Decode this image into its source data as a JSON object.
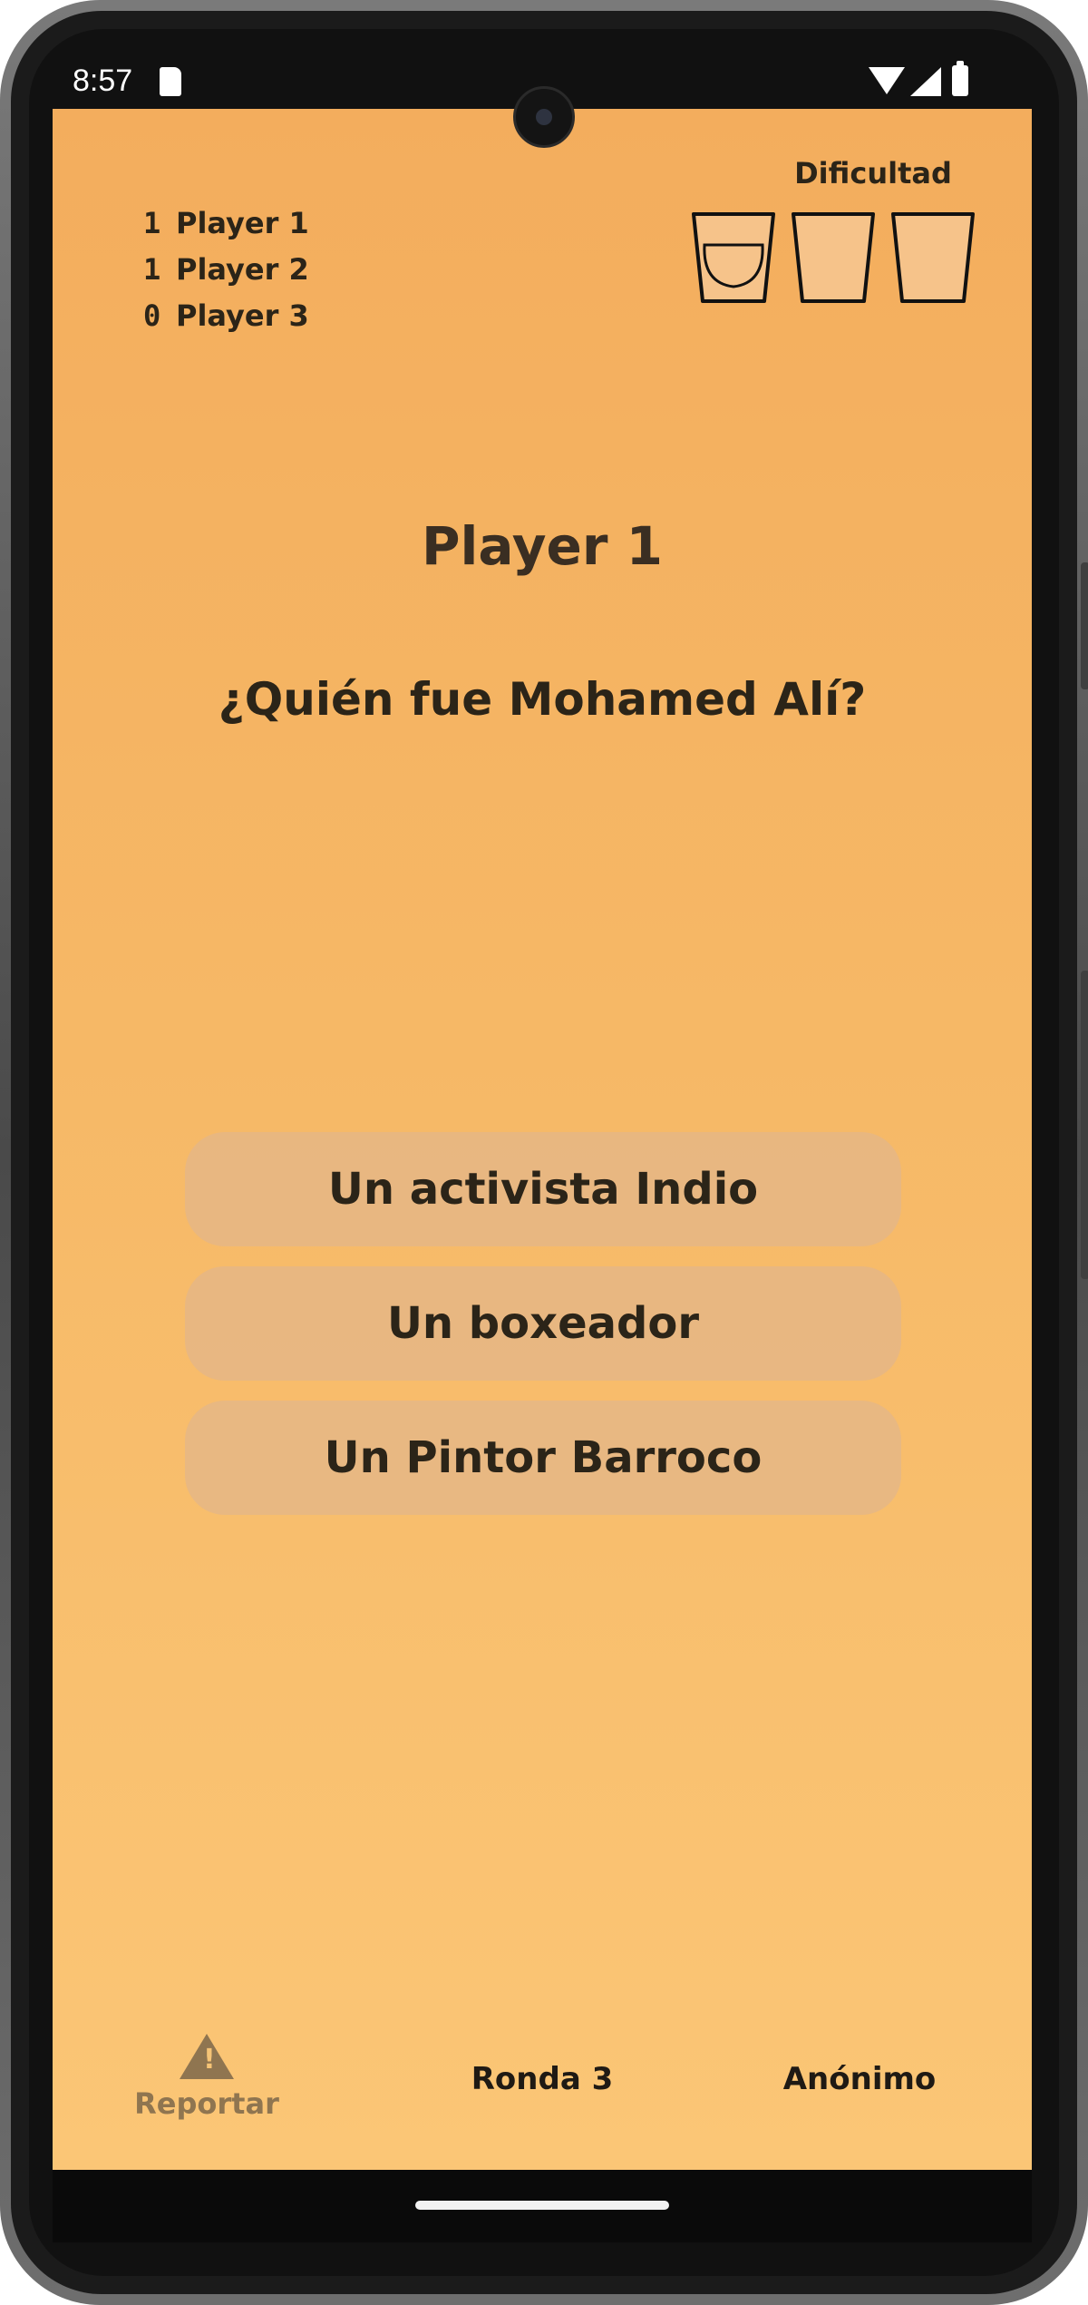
{
  "status_bar": {
    "time": "8:57",
    "icons": [
      "sd-card-icon",
      "wifi-icon",
      "signal-icon",
      "battery-icon"
    ]
  },
  "scoreboard": [
    {
      "score": "1",
      "name": "Player 1"
    },
    {
      "score": "1",
      "name": "Player 2"
    },
    {
      "score": "0",
      "name": "Player 3"
    }
  ],
  "difficulty": {
    "label": "Dificultad",
    "level": 1,
    "max": 3,
    "icon": "glass-icon"
  },
  "current_player": "Player 1",
  "question": "¿Quién fue Mohamed Alí?",
  "answers": [
    {
      "label": "Un activista Indio"
    },
    {
      "label": "Un boxeador"
    },
    {
      "label": "Un Pintor Barroco"
    }
  ],
  "footer": {
    "report_label": "Reportar",
    "report_icon": "warning-icon",
    "round_label": "Ronda 3",
    "mode_label": "Anónimo"
  },
  "colors": {
    "background_top": "#f3ad5d",
    "background_bottom": "#fbc676",
    "answer_button": "#e4b68a",
    "text_dark": "#2b2418",
    "report_muted": "#8f7550"
  }
}
